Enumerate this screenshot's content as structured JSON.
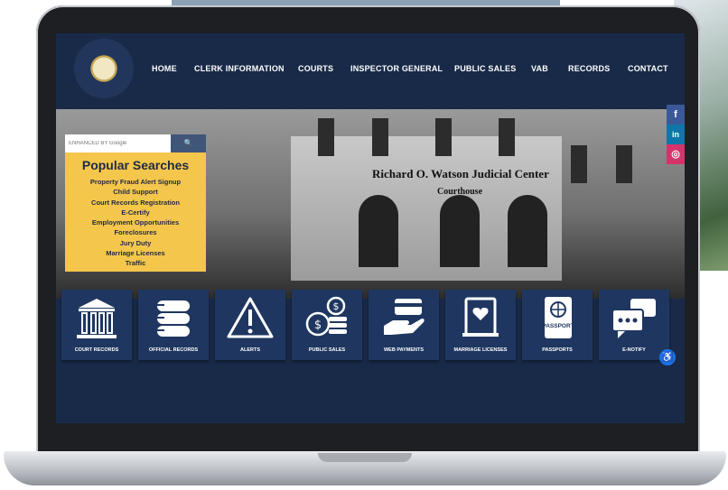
{
  "nav": {
    "items": [
      "HOME",
      "CLERK INFORMATION",
      "COURTS",
      "INSPECTOR GENERAL",
      "PUBLIC SALES",
      "VAB",
      "RECORDS",
      "CONTACT"
    ]
  },
  "search": {
    "placeholder": "ENHANCED BY Google",
    "button_icon": "search-icon"
  },
  "popular": {
    "title": "Popular Searches",
    "items": [
      "Property Fraud Alert Signup",
      "Child Support",
      "Court Records Registration",
      "E-Certify",
      "Employment Opportunities",
      "Foreclosures",
      "Jury Duty",
      "Marriage Licenses",
      "Traffic"
    ]
  },
  "hero": {
    "sign_title": "Richard O. Watson Judicial Center",
    "sign_subtitle": "Courthouse"
  },
  "social": {
    "items": [
      {
        "icon": "facebook-icon",
        "glyph": "f",
        "color": "#3b5998"
      },
      {
        "icon": "linkedin-icon",
        "glyph": "in",
        "color": "#0e76a8"
      },
      {
        "icon": "instagram-icon",
        "glyph": "◎",
        "color": "#d6336c"
      }
    ]
  },
  "tiles": {
    "items": [
      {
        "label": "COURT RECORDS",
        "icon": "courthouse-icon"
      },
      {
        "label": "OFFICIAL RECORDS",
        "icon": "books-icon"
      },
      {
        "label": "ALERTS",
        "icon": "alert-icon"
      },
      {
        "label": "PUBLIC SALES",
        "icon": "coins-icon"
      },
      {
        "label": "WEB PAYMENTS",
        "icon": "payment-hand-icon"
      },
      {
        "label": "MARRIAGE LICENSES",
        "icon": "marriage-certificate-icon"
      },
      {
        "label": "PASSPORTS",
        "icon": "passport-icon"
      },
      {
        "label": "E-NOTIFY",
        "icon": "chat-icon"
      }
    ],
    "passport_text": "PASSPORT"
  },
  "colors": {
    "header_bg": "#182a48",
    "tile_bg": "#1f3760",
    "popular_bg": "#f5c64c"
  }
}
